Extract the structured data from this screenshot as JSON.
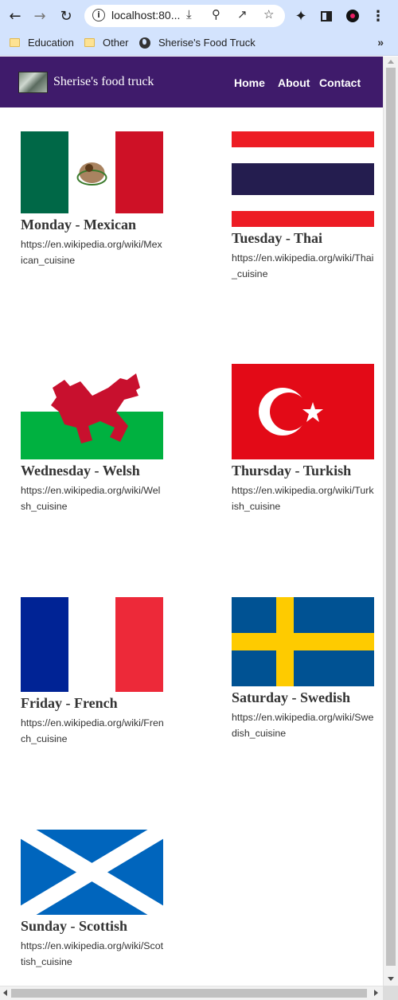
{
  "browser": {
    "url": "localhost:80...",
    "bookmarks": [
      {
        "label": "Education",
        "icon": "folder-icon"
      },
      {
        "label": "Other",
        "icon": "folder-icon"
      },
      {
        "label": "Sherise's Food Truck",
        "icon": "globe-icon"
      }
    ],
    "more_label": "»"
  },
  "site": {
    "brand": "Sherise's food truck",
    "nav": [
      "Home",
      "About",
      "Contact"
    ]
  },
  "days": [
    {
      "title": "Monday - Mexican",
      "url": "https://en.wikipedia.org/wiki/Mexican_cuisine",
      "flag": "mexico-flag"
    },
    {
      "title": "Tuesday - Thai",
      "url": "https://en.wikipedia.org/wiki/Thai_cuisine",
      "flag": "thailand-flag"
    },
    {
      "title": "Wednesday - Welsh",
      "url": "https://en.wikipedia.org/wiki/Welsh_cuisine",
      "flag": "wales-flag"
    },
    {
      "title": "Thursday - Turkish",
      "url": "https://en.wikipedia.org/wiki/Turkish_cuisine",
      "flag": "turkey-flag"
    },
    {
      "title": "Friday - French",
      "url": "https://en.wikipedia.org/wiki/French_cuisine",
      "flag": "france-flag"
    },
    {
      "title": "Saturday - Swedish",
      "url": "https://en.wikipedia.org/wiki/Swedish_cuisine",
      "flag": "sweden-flag"
    },
    {
      "title": "Sunday - Scottish",
      "url": "https://en.wikipedia.org/wiki/Scottish_cuisine",
      "flag": "scotland-flag"
    }
  ],
  "colors": {
    "navbar": "#3f1b6b",
    "browser_chrome": "#d3e3fd",
    "text": "#333333"
  }
}
